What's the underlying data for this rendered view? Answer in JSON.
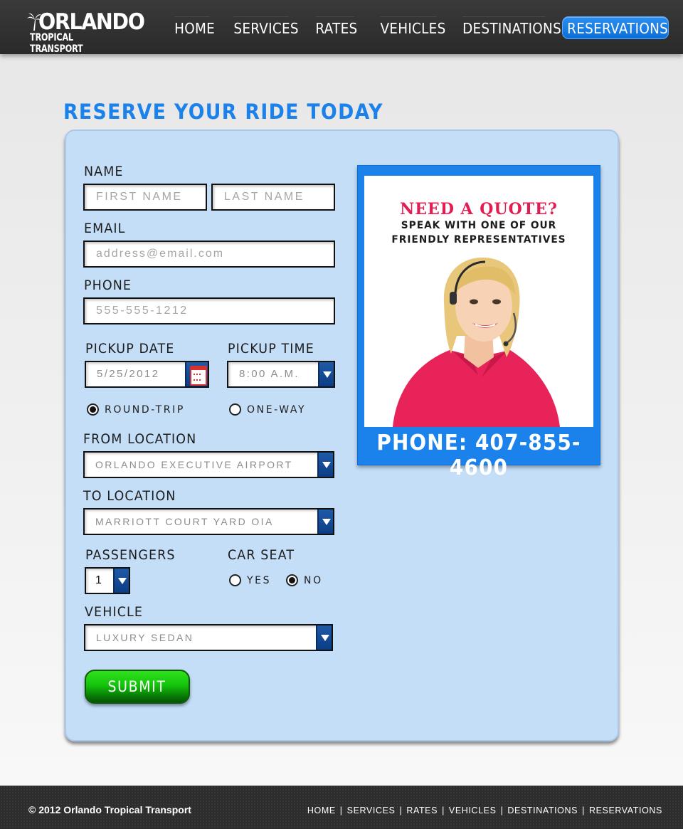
{
  "header": {
    "logo_title": "ORLANDO",
    "logo_subtitle": "TROPICAL TRANSPORT",
    "nav": [
      "HOME",
      "SERVICES",
      "RATES",
      "VEHICLES",
      "DESTINATIONS",
      "RESERVATIONS"
    ],
    "active_nav": "RESERVATIONS"
  },
  "page": {
    "title": "RESERVE YOUR RIDE TODAY"
  },
  "form": {
    "name_label": "NAME",
    "first_name_placeholder": "FIRST NAME",
    "last_name_placeholder": "LAST NAME",
    "email_label": "EMAIL",
    "email_placeholder": "address@email.com",
    "phone_label": "PHONE",
    "phone_placeholder": "555-555-1212",
    "pickup_date_label": "PICKUP DATE",
    "pickup_date_value": "5/25/2012",
    "pickup_time_label": "PICKUP TIME",
    "pickup_time_value": "8:00 A.M.",
    "trip_options": [
      {
        "label": "ROUND-TRIP",
        "checked": true
      },
      {
        "label": "ONE-WAY",
        "checked": false
      }
    ],
    "from_label": "FROM LOCATION",
    "from_value": "ORLANDO EXECUTIVE AIRPORT",
    "to_label": "TO LOCATION",
    "to_value": "MARRIOTT COURT YARD OIA",
    "passengers_label": "PASSENGERS",
    "passengers_value": "1",
    "car_seat_label": "CAR SEAT",
    "car_seat_options": [
      {
        "label": "YES",
        "checked": false
      },
      {
        "label": "NO",
        "checked": true
      }
    ],
    "vehicle_label": "VEHICLE",
    "vehicle_value": "LUXURY SEDAN",
    "submit_label": "SUBMIT"
  },
  "quote": {
    "title": "NEED A QUOTE?",
    "line1": "SPEAK WITH ONE OF OUR",
    "line2": "FRIENDLY REPRESENTATIVES",
    "phone": "PHONE: 407-855-4600"
  },
  "footer": {
    "copyright": "© 2012 Orlando Tropical Transport",
    "nav": [
      "HOME",
      "SERVICES",
      "RATES",
      "VEHICLES",
      "DESTINATIONS",
      "RESERVATIONS"
    ]
  },
  "colors": {
    "accent_blue": "#1a82ea",
    "panel_bg": "#c4def8",
    "quote_red": "#e21d52",
    "submit_green": "#14c40c",
    "header_bg": "#333333"
  }
}
